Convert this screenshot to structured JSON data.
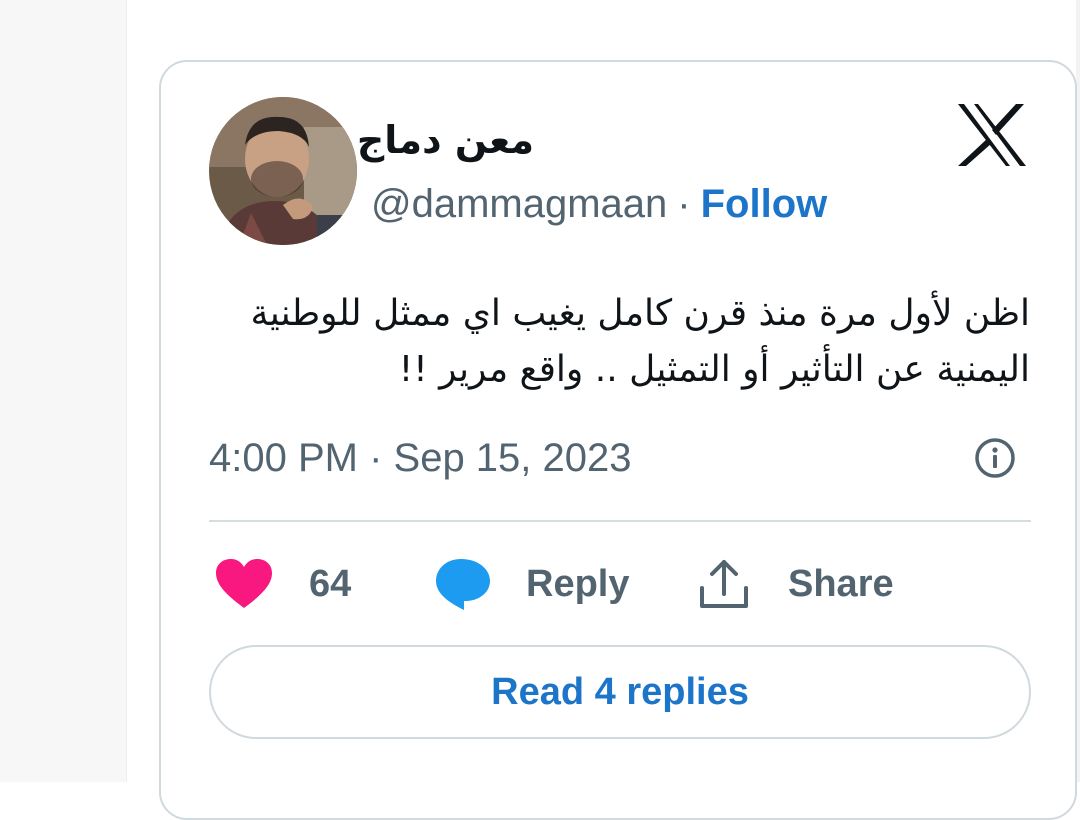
{
  "tweet": {
    "author": {
      "display_name": "معن دماج",
      "handle": "@dammagmaan",
      "separator": "·",
      "follow_label": "Follow"
    },
    "text_lines": [
      "اظن لأول مرة منذ قرن كامل يغيب اي ممثل للوطنية",
      "اليمنية عن التأثير أو التمثيل .. واقع مرير !!"
    ],
    "timestamp": "4:00 PM · Sep 15, 2023",
    "actions": {
      "like_count": "64",
      "reply_label": "Reply",
      "share_label": "Share"
    },
    "read_replies_label": "Read 4 replies"
  },
  "icons": {
    "brand": "x-logo-icon",
    "info": "info-icon",
    "like": "heart-icon",
    "reply": "speech-bubble-icon",
    "share": "share-upload-icon"
  },
  "colors": {
    "link_blue": "#1d75c9",
    "like_pink": "#f91880",
    "reply_blue": "#1d9bf0",
    "muted_gray": "#536471",
    "text_dark": "#0f1419",
    "border": "#cfd9de"
  }
}
